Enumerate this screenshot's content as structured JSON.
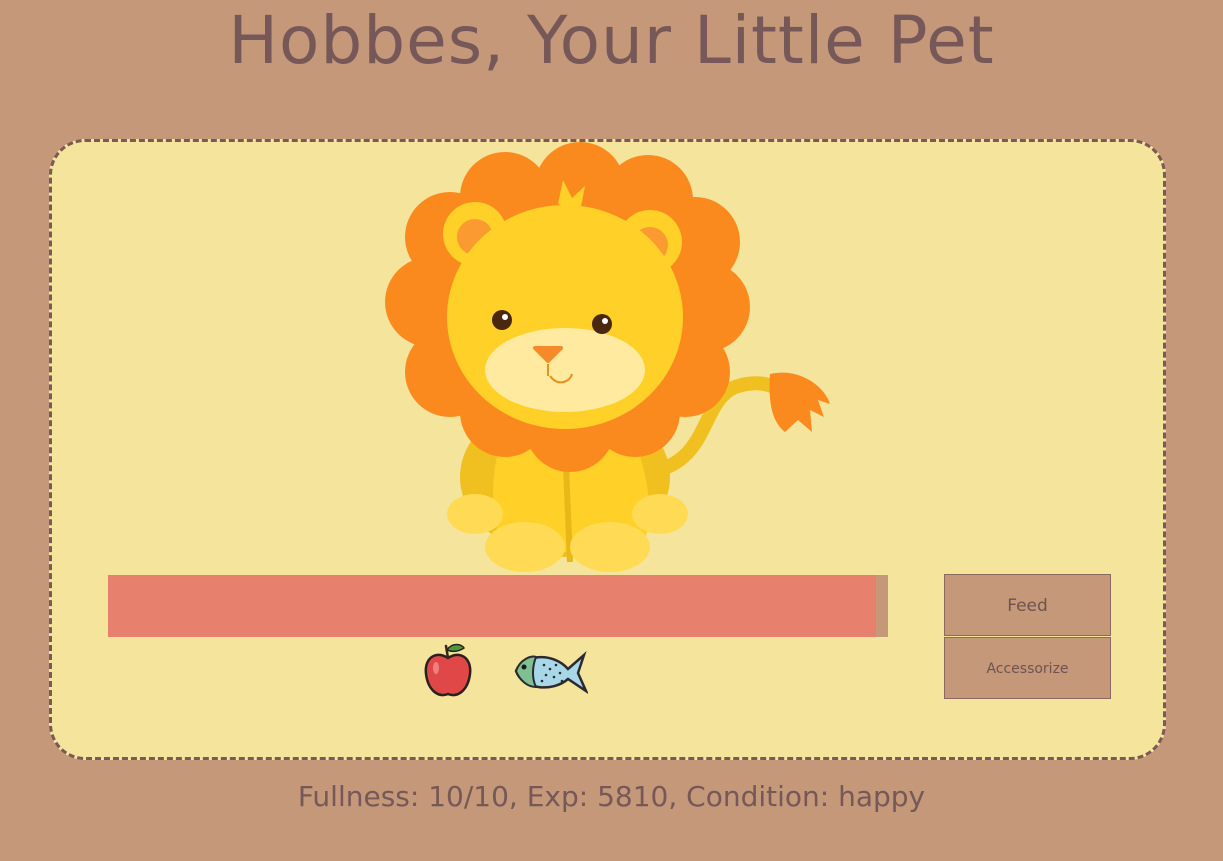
{
  "header": {
    "title": "Hobbes, Your Little Pet"
  },
  "pet": {
    "icon": "lion-cub-illustration"
  },
  "fullness_bar": {
    "fill_fraction": 0.985,
    "fill_color": "#e8806e",
    "track_color": "#c49878"
  },
  "food_items": [
    {
      "icon": "apple-icon"
    },
    {
      "icon": "fish-icon"
    }
  ],
  "actions": {
    "feed_label": "Feed",
    "accessorize_label": "Accessorize"
  },
  "status": {
    "text": "Fullness: 10/10, Exp: 5810, Condition: happy"
  },
  "colors": {
    "background": "#c49878",
    "panel": "#f5e49c",
    "text": "#775858"
  }
}
